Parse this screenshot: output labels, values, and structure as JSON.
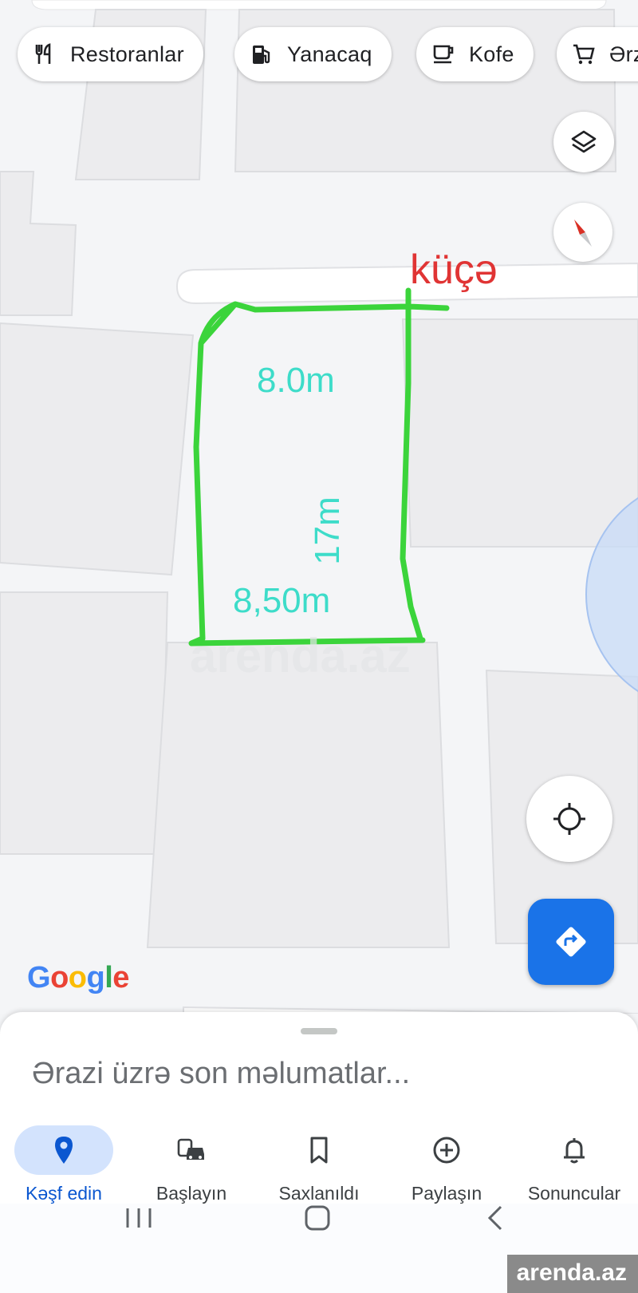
{
  "chips": [
    {
      "label": "Restoranlar",
      "icon": "restaurant-icon"
    },
    {
      "label": "Yanacaq",
      "icon": "gas-station-icon"
    },
    {
      "label": "Kofe",
      "icon": "coffee-icon"
    },
    {
      "label": "Ərzaq",
      "icon": "cart-icon"
    }
  ],
  "map": {
    "street_label": "küçə",
    "width_top": "8.0m",
    "length": "17m",
    "width_bottom": "8,50m",
    "google_logo": [
      "G",
      "o",
      "o",
      "g",
      "l",
      "e"
    ],
    "google_colors": [
      "#4285f4",
      "#ea4335",
      "#fbbc05",
      "#4285f4",
      "#34a853",
      "#ea4335"
    ],
    "outline_color": "#3bd43b",
    "measure_color": "#3ddcc9"
  },
  "sheet": {
    "title": "Ərazi üzrə son məlumatlar..."
  },
  "nav": {
    "items": [
      {
        "label": "Kəşf edin",
        "icon": "location-pin-icon",
        "active": true
      },
      {
        "label": "Başlayın",
        "icon": "commute-icon",
        "active": false
      },
      {
        "label": "Saxlanıldı",
        "icon": "bookmark-icon",
        "active": false
      },
      {
        "label": "Paylaşın",
        "icon": "add-circle-icon",
        "active": false
      },
      {
        "label": "Sonuncular",
        "icon": "bell-icon",
        "active": false
      }
    ]
  },
  "watermark": "arenda.az",
  "colors": {
    "accent": "#1a73e8",
    "active_nav": "#0b57d0",
    "active_pill": "#d3e3fd"
  }
}
